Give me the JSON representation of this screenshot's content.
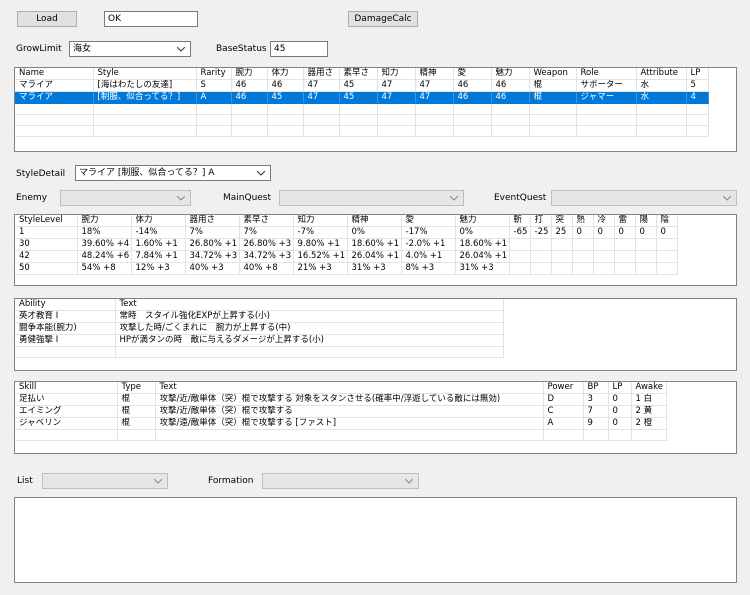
{
  "toolbar": {
    "load_label": "Load",
    "load_value": "OK",
    "damage_calc_label": "DamageCalc"
  },
  "filters": {
    "grow_limit_label": "GrowLimit",
    "grow_limit_value": "海女",
    "base_status_label": "BaseStatus",
    "base_status_value": "45"
  },
  "characters": {
    "headers": [
      "Name",
      "Style",
      "Rarity",
      "腕力",
      "体力",
      "器用さ",
      "素早さ",
      "知力",
      "精神",
      "愛",
      "魅力",
      "Weapon",
      "Role",
      "Attribute",
      "LP"
    ],
    "rows": [
      [
        "マライア",
        "[海はわたしの友達]",
        "S",
        "46",
        "46",
        "47",
        "45",
        "47",
        "47",
        "46",
        "46",
        "棍",
        "サポーター",
        "水",
        "5"
      ],
      [
        "マライア",
        "[制服、似合ってる？]",
        "A",
        "46",
        "45",
        "47",
        "45",
        "47",
        "47",
        "46",
        "46",
        "棍",
        "ジャマー",
        "水",
        "4"
      ]
    ]
  },
  "style_detail": {
    "label": "StyleDetail",
    "value": "マライア [制服、似合ってる？] A"
  },
  "quests": {
    "enemy_label": "Enemy",
    "main_quest_label": "MainQuest",
    "event_quest_label": "EventQuest"
  },
  "style_levels": {
    "headers": [
      "StyleLevel",
      "腕力",
      "体力",
      "器用さ",
      "素早さ",
      "知力",
      "精神",
      "愛",
      "魅力",
      "斬",
      "打",
      "突",
      "熱",
      "冷",
      "雷",
      "陽",
      "陰"
    ],
    "rows": [
      [
        "1",
        "18%",
        "-14%",
        "7%",
        "7%",
        "-7%",
        "0%",
        "-17%",
        "0%",
        "-65",
        "-25",
        "25",
        "0",
        "0",
        "0",
        "0",
        "0"
      ],
      [
        "30",
        "39.60% +4",
        "1.60% +1",
        "26.80% +1",
        "26.80% +3",
        "9.80% +1",
        "18.60% +1",
        "-2.0% +1",
        "18.60% +1",
        "",
        "",
        "",
        "",
        "",
        "",
        "",
        ""
      ],
      [
        "42",
        "48.24% +6",
        "7.84% +1",
        "34.72% +3",
        "34.72% +3",
        "16.52% +1",
        "26.04% +1",
        "4.0% +1",
        "26.04% +1",
        "",
        "",
        "",
        "",
        "",
        "",
        "",
        ""
      ],
      [
        "50",
        "54% +8",
        "12% +3",
        "40% +3",
        "40% +8",
        "21% +3",
        "31% +3",
        "8% +3",
        "31% +3",
        "",
        "",
        "",
        "",
        "",
        "",
        "",
        ""
      ]
    ]
  },
  "abilities": {
    "headers": [
      "Ability",
      "Text"
    ],
    "rows": [
      [
        "英才教育 I",
        "常時　スタイル強化EXPが上昇する(小)"
      ],
      [
        "闘争本能(腕力)",
        "攻撃した時/ごくまれに　腕力が上昇する(中)"
      ],
      [
        "勇健強撃 I",
        "HPが満タンの時　敵に与えるダメージが上昇する(小)"
      ]
    ]
  },
  "skills": {
    "headers": [
      "Skill",
      "Type",
      "Text",
      "Power",
      "BP",
      "LP",
      "Awake"
    ],
    "rows": [
      [
        "足払い",
        "棍",
        "攻撃/近/敵単体（突）棍で攻撃する 対象をスタンさせる(確率中/浮遊している敵には無効)",
        "D",
        "3",
        "0",
        "1 白"
      ],
      [
        "エイミング",
        "棍",
        "攻撃/近/敵単体（突）棍で攻撃する",
        "C",
        "7",
        "0",
        "2 黄"
      ],
      [
        "ジャベリン",
        "棍",
        "攻撃/遠/敵単体（突）棍で攻撃する [ファスト]",
        "A",
        "9",
        "0",
        "2 橙"
      ]
    ]
  },
  "bottom": {
    "list_label": "List",
    "formation_label": "Formation"
  },
  "colors": {
    "selection": "#0078d7",
    "background": "#f0f0f0"
  }
}
